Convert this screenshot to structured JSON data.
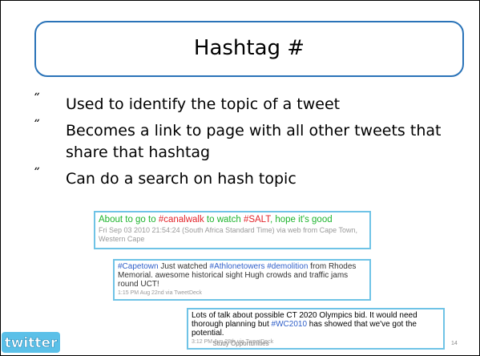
{
  "slide": {
    "title": "Hashtag #",
    "bullet_mark": "˝",
    "bullets": [
      "Used to identify the topic of a tweet",
      "Becomes a link to page with all other tweets that share that hashtag",
      "Can do a search on hash topic"
    ],
    "footer": "Study Opportunities",
    "page_number": "14",
    "logo_text": "twitter"
  },
  "tweets": [
    {
      "parts": [
        "About to go to ",
        "#canalwalk",
        " to watch ",
        "#SALT",
        ", hope it's good"
      ],
      "meta": "Fri Sep 03 2010 21:54:24 (South Africa Standard Time) via web from Cape Town, Western Cape"
    },
    {
      "parts": [
        "#Capetown",
        " Just watched ",
        "#Athlonetowers",
        " ",
        "#demolition",
        " from Rhodes Memorial. awesome historical sight Hugh crowds and traffic jams round UCT!"
      ],
      "meta": "1:15 PM Aug 22nd via TweetDeck"
    },
    {
      "parts": [
        "Lots of talk about possible CT 2020 Olympics bid. It would need thorough planning but ",
        "#WC2010",
        " has showed that we've got the potential."
      ],
      "meta": "3:12 PM Jun 28th via TweetDeck"
    }
  ],
  "colors": {
    "title_border": "#2a73b8",
    "tweet_border": "#6fc3e6",
    "tweet1_text": "#1fb52f",
    "tweet1_tag": "#e3262c",
    "tag_blue": "#2f5fc9",
    "logo_bg": "#5bc0e8"
  }
}
